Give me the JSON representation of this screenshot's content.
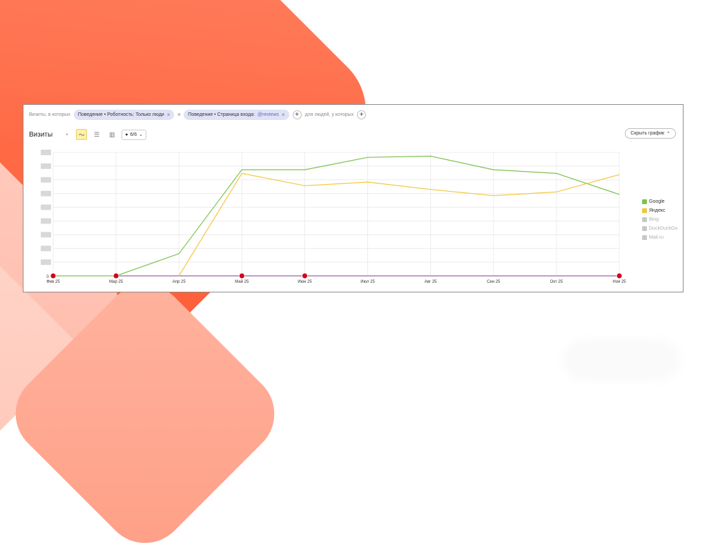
{
  "filters": {
    "prefix": "Визиты, в которых",
    "chip1": "Поведение • Роботность: Только люди",
    "connector": "и",
    "chip2_prefix": "Поведение • Страница входа:",
    "chip2_value": "@reviews",
    "suffix": "для людей, у которых"
  },
  "header": {
    "title": "Визиты",
    "series_count": "6/6",
    "hide_chart_label": "Скрыть график"
  },
  "legend": [
    {
      "name": "Google",
      "color": "#7dc24b",
      "enabled": true
    },
    {
      "name": "Яндекс",
      "color": "#f4c63d",
      "enabled": true
    },
    {
      "name": "Bing",
      "color": "#c8c8c8",
      "enabled": false
    },
    {
      "name": "DuckDuckGo",
      "color": "#c8c8c8",
      "enabled": false
    },
    {
      "name": "Mail.ru",
      "color": "#c8c8c8",
      "enabled": false
    }
  ],
  "chart_data": {
    "type": "line",
    "categories": [
      "Фев 25",
      "Мар 25",
      "Апр 25",
      "Май 25",
      "Июн 25",
      "Июл 25",
      "Авг 25",
      "Сен 25",
      "Окт 25",
      "Ноя 25"
    ],
    "y_zero_label": "0",
    "ylim": [
      0,
      100
    ],
    "grid": true,
    "series": [
      {
        "name": "Google",
        "color": "#7dc24b",
        "values": [
          0,
          0,
          18,
          86,
          86,
          96,
          97,
          86,
          83,
          66
        ]
      },
      {
        "name": "Яндекс",
        "color": "#f4c63d",
        "values": [
          null,
          null,
          0,
          83,
          73,
          76,
          70,
          65,
          68,
          82
        ]
      }
    ],
    "annotation_markers": [
      0,
      1,
      3,
      4,
      9
    ]
  }
}
